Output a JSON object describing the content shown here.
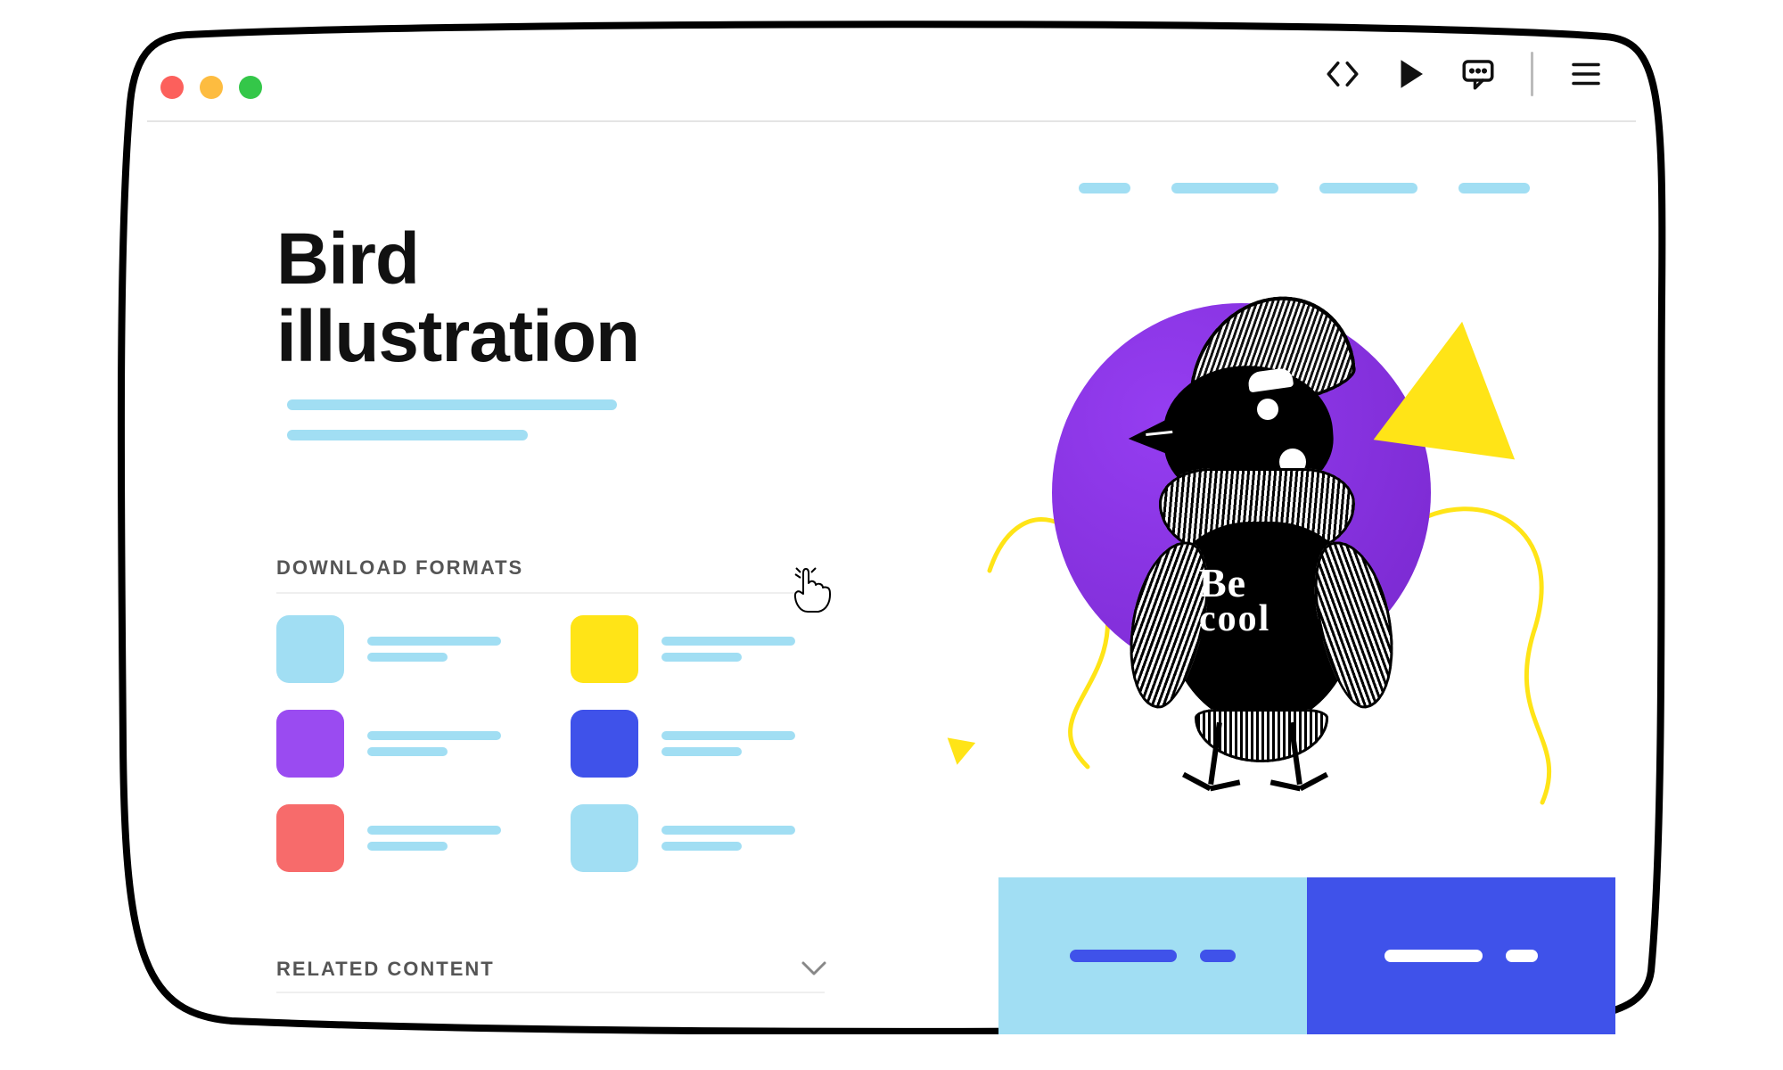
{
  "colors": {
    "cyan": "#a1def3",
    "purple": "#9a4bf1",
    "coral": "#f76b6b",
    "yellow": "#ffe417",
    "blue": "#3f52ea"
  },
  "window": {
    "traffic_lights": [
      "red",
      "yellow",
      "green"
    ],
    "tools": [
      "code-icon",
      "play-icon",
      "comment-icon",
      "menu-icon"
    ]
  },
  "nav_placeholder_widths": [
    58,
    120,
    110,
    80
  ],
  "page": {
    "title": "Bird\nillustration",
    "subtitle_line_widths": [
      370,
      270
    ],
    "illustration_text": {
      "line1": "Be",
      "line2": "cool"
    }
  },
  "downloads": {
    "heading": "DOWNLOAD FORMATS",
    "items": [
      {
        "color": "cyan"
      },
      {
        "color": "purple"
      },
      {
        "color": "coral"
      },
      {
        "color": "yellow"
      },
      {
        "color": "blue"
      },
      {
        "color": "cyan"
      }
    ]
  },
  "related": {
    "heading": "RELATED CONTENT"
  },
  "bottom_buttons": {
    "a_segment_widths": [
      120,
      40
    ],
    "b_segment_widths": [
      110,
      36
    ]
  }
}
